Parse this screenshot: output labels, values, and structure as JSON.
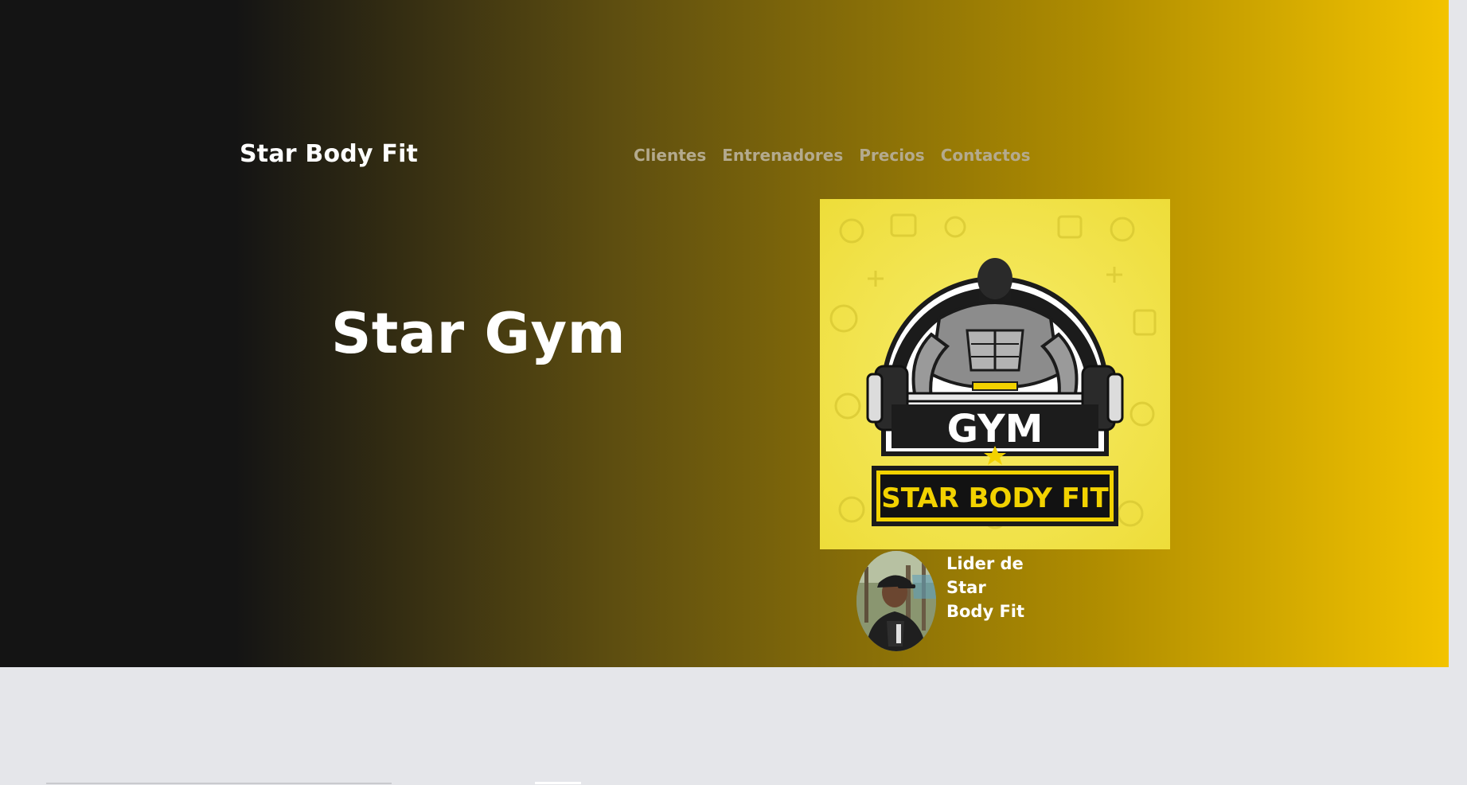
{
  "site": {
    "brand": "Star Body Fit"
  },
  "nav": {
    "items": [
      {
        "label": "Clientes"
      },
      {
        "label": "Entrenadores"
      },
      {
        "label": "Precios"
      },
      {
        "label": "Contactos"
      }
    ]
  },
  "hero": {
    "headline": "Star Gym",
    "logo": {
      "top_text": "GYM",
      "bottom_text": "STAR BODY FIT"
    },
    "leader_caption": "Lider de Star Body Fit"
  },
  "colors": {
    "accent_yellow": "#f6c600",
    "dark": "#141414",
    "nav_text": "#b4aa8e",
    "page_bg": "#e5e6ea"
  },
  "icons": [
    "gym-logo-emblem",
    "avatar-photo"
  ]
}
